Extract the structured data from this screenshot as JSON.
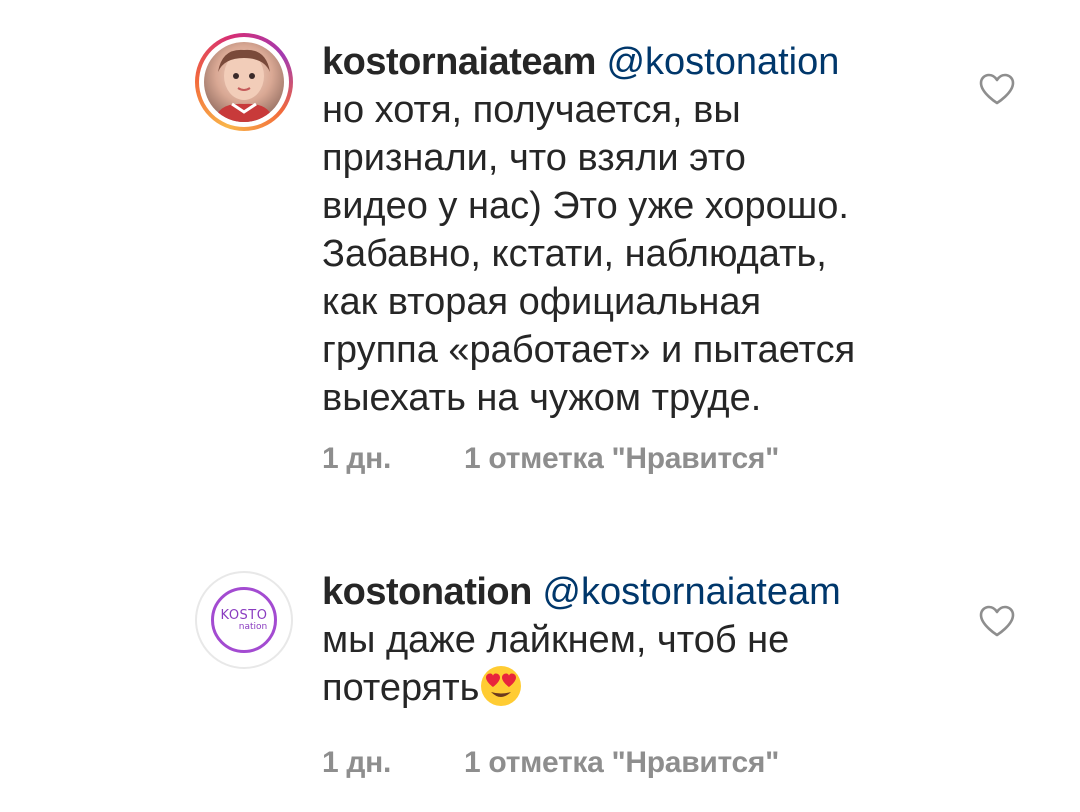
{
  "comments": [
    {
      "username": "kostornaiateam",
      "mention": "@kostonation",
      "lines": [
        "но хотя, получается, вы",
        "признали, что взяли это",
        "видео у нас) Это уже хорошо.",
        "Забавно, кстати, наблюдать,",
        "как вторая официальная",
        "группа «работает» и пытается",
        "выехать на чужом труде."
      ],
      "time": "1 дн.",
      "likes": "1 отметка \"Нравится\"",
      "avatar_icon": "profile-photo",
      "like_icon": "heart-outline-icon"
    },
    {
      "username": "kostonation",
      "mention": "@kostornaiateam",
      "lines": [
        "мы даже лайкнем, чтоб не",
        "потерять"
      ],
      "emoji": "heart-eyes-emoji",
      "time": "1 дн.",
      "likes": "1 отметка \"Нравится\"",
      "avatar_logo": {
        "line1": "KOSTO",
        "line2": "nation"
      },
      "like_icon": "heart-outline-icon"
    }
  ],
  "colors": {
    "text": "#262626",
    "mention": "#00376b",
    "meta": "#8e8e8e",
    "logo": "#a34bd1"
  }
}
